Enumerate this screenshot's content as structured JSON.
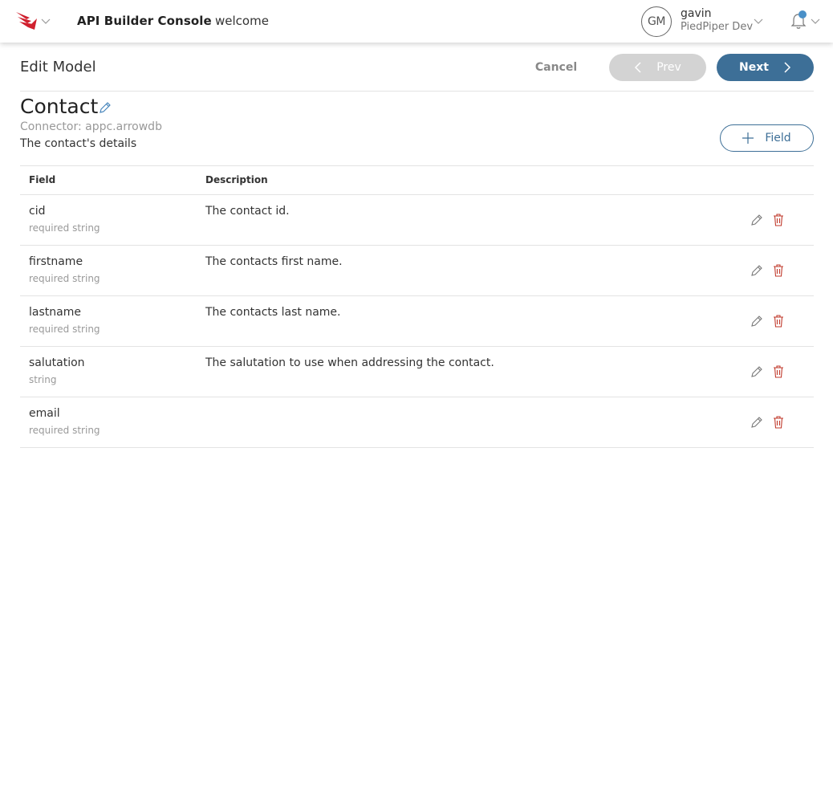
{
  "colors": {
    "brand_red": "#d0202e",
    "primary": "#3d6f97",
    "disabled": "#d3d3d3",
    "delete": "#c0392b",
    "notification_dot": "#4a90c8"
  },
  "topbar": {
    "logo_icon": "axway-logo-icon",
    "app_title": "API Builder Console",
    "nav_item": "welcome",
    "avatar_initials": "GM",
    "user_name": "gavin",
    "user_org": "PiedPiper Dev",
    "notifications_icon": "bell-icon"
  },
  "header": {
    "title": "Edit Model",
    "cancel_label": "Cancel",
    "prev_label": "Prev",
    "next_label": "Next"
  },
  "model": {
    "name": "Contact",
    "connector": "Connector:  appc.arrowdb",
    "description": "The contact's details",
    "add_field_label": "Field"
  },
  "table": {
    "columns": [
      "Field",
      "Description"
    ],
    "rows": [
      {
        "name": "cid",
        "type": "required string",
        "description": "The contact id."
      },
      {
        "name": "firstname",
        "type": "required string",
        "description": "The contacts first name."
      },
      {
        "name": "lastname",
        "type": "required string",
        "description": "The contacts last name."
      },
      {
        "name": "salutation",
        "type": "string",
        "description": "The salutation to use when addressing the contact."
      },
      {
        "name": "email",
        "type": "required string",
        "description": ""
      }
    ]
  }
}
